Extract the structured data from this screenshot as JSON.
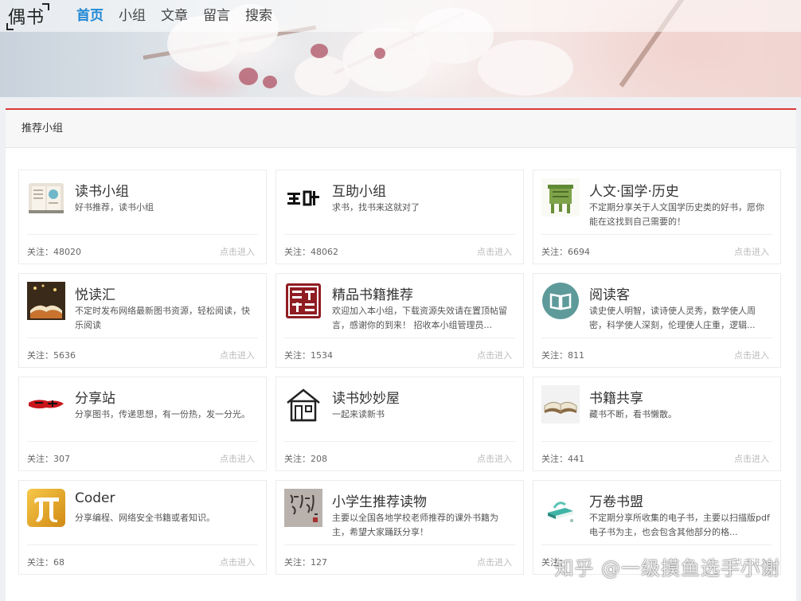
{
  "site": {
    "logo_text": "偶书",
    "nav": [
      {
        "label": "首页",
        "active": true
      },
      {
        "label": "小组",
        "active": false
      },
      {
        "label": "文章",
        "active": false
      },
      {
        "label": "留言",
        "active": false
      },
      {
        "label": "搜索",
        "active": false
      }
    ]
  },
  "section": {
    "title": "推荐小组"
  },
  "labels": {
    "follow_prefix": "关注：",
    "enter": "点击进入"
  },
  "groups": [
    {
      "name": "读书小组",
      "desc": "好书推荐，读书小组",
      "followers": "48020",
      "icon": "book-notebook-icon"
    },
    {
      "name": "互助小组",
      "desc": "求书，找书来这就对了",
      "followers": "48062",
      "icon": "huzhu-calligraphy-icon"
    },
    {
      "name": "人文·国学·历史",
      "desc": "不定期分享关于人文国学历史类的好书，愿你能在这找到自己需要的！",
      "followers": "6694",
      "icon": "bronze-ding-icon"
    },
    {
      "name": "悦读汇",
      "desc": "不定时发布网络最新图书资源，轻松阅读，快乐阅读",
      "followers": "5636",
      "icon": "open-book-photo-icon"
    },
    {
      "name": "精品书籍推荐",
      "desc": "欢迎加入本小组，下载资源失效请在置顶帖留言，感谢你的到来！ 招收本小组管理员...",
      "followers": "1534",
      "icon": "seal-stamp-icon"
    },
    {
      "name": "阅读客",
      "desc": "读史使人明智，读诗使人灵秀，数学使人周密，科学使人深刻，伦理使人庄重，逻辑...",
      "followers": "811",
      "icon": "book-circle-icon"
    },
    {
      "name": "分享站",
      "desc": "分享图书，传递思想，有一份热，发一分光。",
      "followers": "307",
      "icon": "red-brush-icon"
    },
    {
      "name": "读书妙妙屋",
      "desc": "一起来读新书",
      "followers": "208",
      "icon": "house-icon"
    },
    {
      "name": "书籍共享",
      "desc": "藏书不断，看书懒散。",
      "followers": "441",
      "icon": "open-book-icon"
    },
    {
      "name": "Coder",
      "desc": "分享编程、网络安全书籍或者知识。",
      "followers": "68",
      "icon": "pi-icon"
    },
    {
      "name": "小学生推荐读物",
      "desc": "主要以全国各地学校老师推荐的课外书籍为主，希望大家踊跃分享！",
      "followers": "127",
      "icon": "calligraphy-scroll-icon"
    },
    {
      "name": "万卷书盟",
      "desc": "不定期分享所收集的电子书，主要以扫描版pdf电子书为主，也会包含其他部分的格...",
      "followers": "",
      "icon": "books-teal-icon"
    }
  ],
  "watermark": "知乎 @一级摸鱼选手小谢",
  "colors": {
    "accent": "#1f87d4",
    "panel_top_border": "#d93a3a"
  }
}
